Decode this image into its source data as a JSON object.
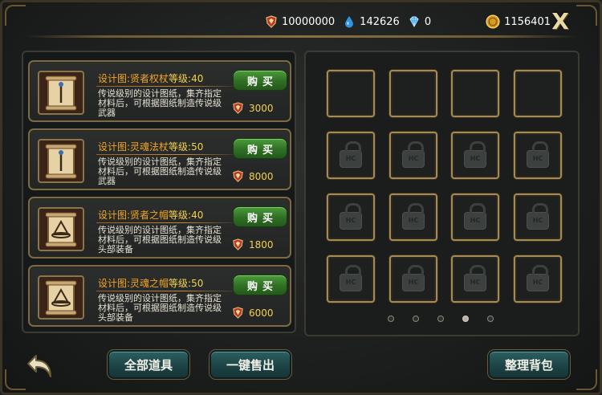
{
  "currency": {
    "honor": {
      "value": "10000000",
      "icon": "shield-badge-icon",
      "color": "#c8412a"
    },
    "water": {
      "value": "142626",
      "icon": "water-drop-icon",
      "color": "#3da7f0"
    },
    "diamond": {
      "value": "0",
      "icon": "diamond-icon",
      "color": "#4fb7ff"
    },
    "gold": {
      "value": "1156401",
      "icon": "gold-coin-icon",
      "color": "#e0a526"
    }
  },
  "close_label": "X",
  "shop_items": [
    {
      "name": "设计图:贤者权杖",
      "level": "等级:40",
      "description": "传说级别的设计图纸，集齐指定材料后，可根据图纸制造传说级武器",
      "buy_label": "购买",
      "price": "3000",
      "icon": "scroll-staff-icon"
    },
    {
      "name": "设计图:灵魂法杖",
      "level": "等级:50",
      "description": "传说级别的设计图纸，集齐指定材料后，可根据图纸制造传说级武器",
      "buy_label": "购买",
      "price": "8000",
      "icon": "scroll-staff-icon"
    },
    {
      "name": "设计图:贤者之帽",
      "level": "等级:40",
      "description": "传说级别的设计图纸，集齐指定材料后，可根据图纸制造传说级头部装备",
      "buy_label": "购买",
      "price": "1800",
      "icon": "scroll-hat-icon"
    },
    {
      "name": "设计图:灵魂之帽",
      "level": "等级:50",
      "description": "传说级别的设计图纸，集齐指定材料后，可根据图纸制造传说级头部装备",
      "buy_label": "购买",
      "price": "6000",
      "icon": "scroll-hat-icon"
    }
  ],
  "bag": {
    "lock_label": "HC",
    "total_pages": 5,
    "active_page": 4,
    "unlocked_slots": 4,
    "locked_slots": 12
  },
  "buttons": {
    "all_items": "全部道具",
    "quick_sell": "一键售出",
    "sort_bag": "整理背包"
  }
}
